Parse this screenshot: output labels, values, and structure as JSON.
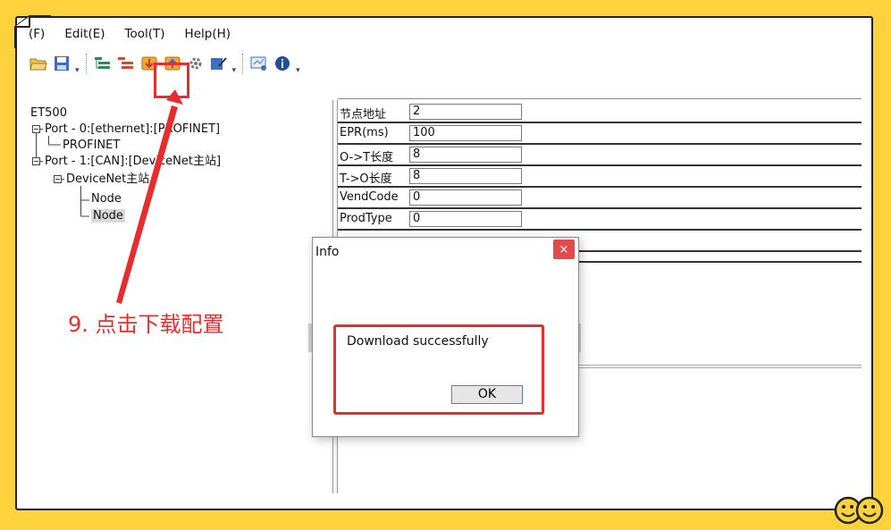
{
  "menu": {
    "file": "(F)",
    "edit": "Edit(E)",
    "tool": "Tool(T)",
    "help": "Help(H)"
  },
  "tree": {
    "root": "ET500",
    "port0": "Port - 0:[ethernet]:[PROFINET]",
    "port0_child": "PROFINET",
    "port1": "Port - 1:[CAN]:[DeviceNet主站]",
    "port1_child": "DeviceNet主站",
    "node1": "Node",
    "node2": "Node"
  },
  "properties": [
    {
      "label": "节点地址",
      "value": "2"
    },
    {
      "label": "EPR(ms)",
      "value": "100"
    },
    {
      "label": "O->T长度",
      "value": "8"
    },
    {
      "label": "T->O长度",
      "value": "8"
    },
    {
      "label": "VendCode",
      "value": "0"
    },
    {
      "label": "ProdType",
      "value": "0"
    }
  ],
  "dialog": {
    "title": "Info",
    "close": "×",
    "message": "Download successfully",
    "ok": "OK"
  },
  "annotation": {
    "text": "9. 点击下载配置"
  },
  "colors": {
    "background": "#FDD23C",
    "highlight": "#E62E2E",
    "close_button": "#E24B4B"
  }
}
